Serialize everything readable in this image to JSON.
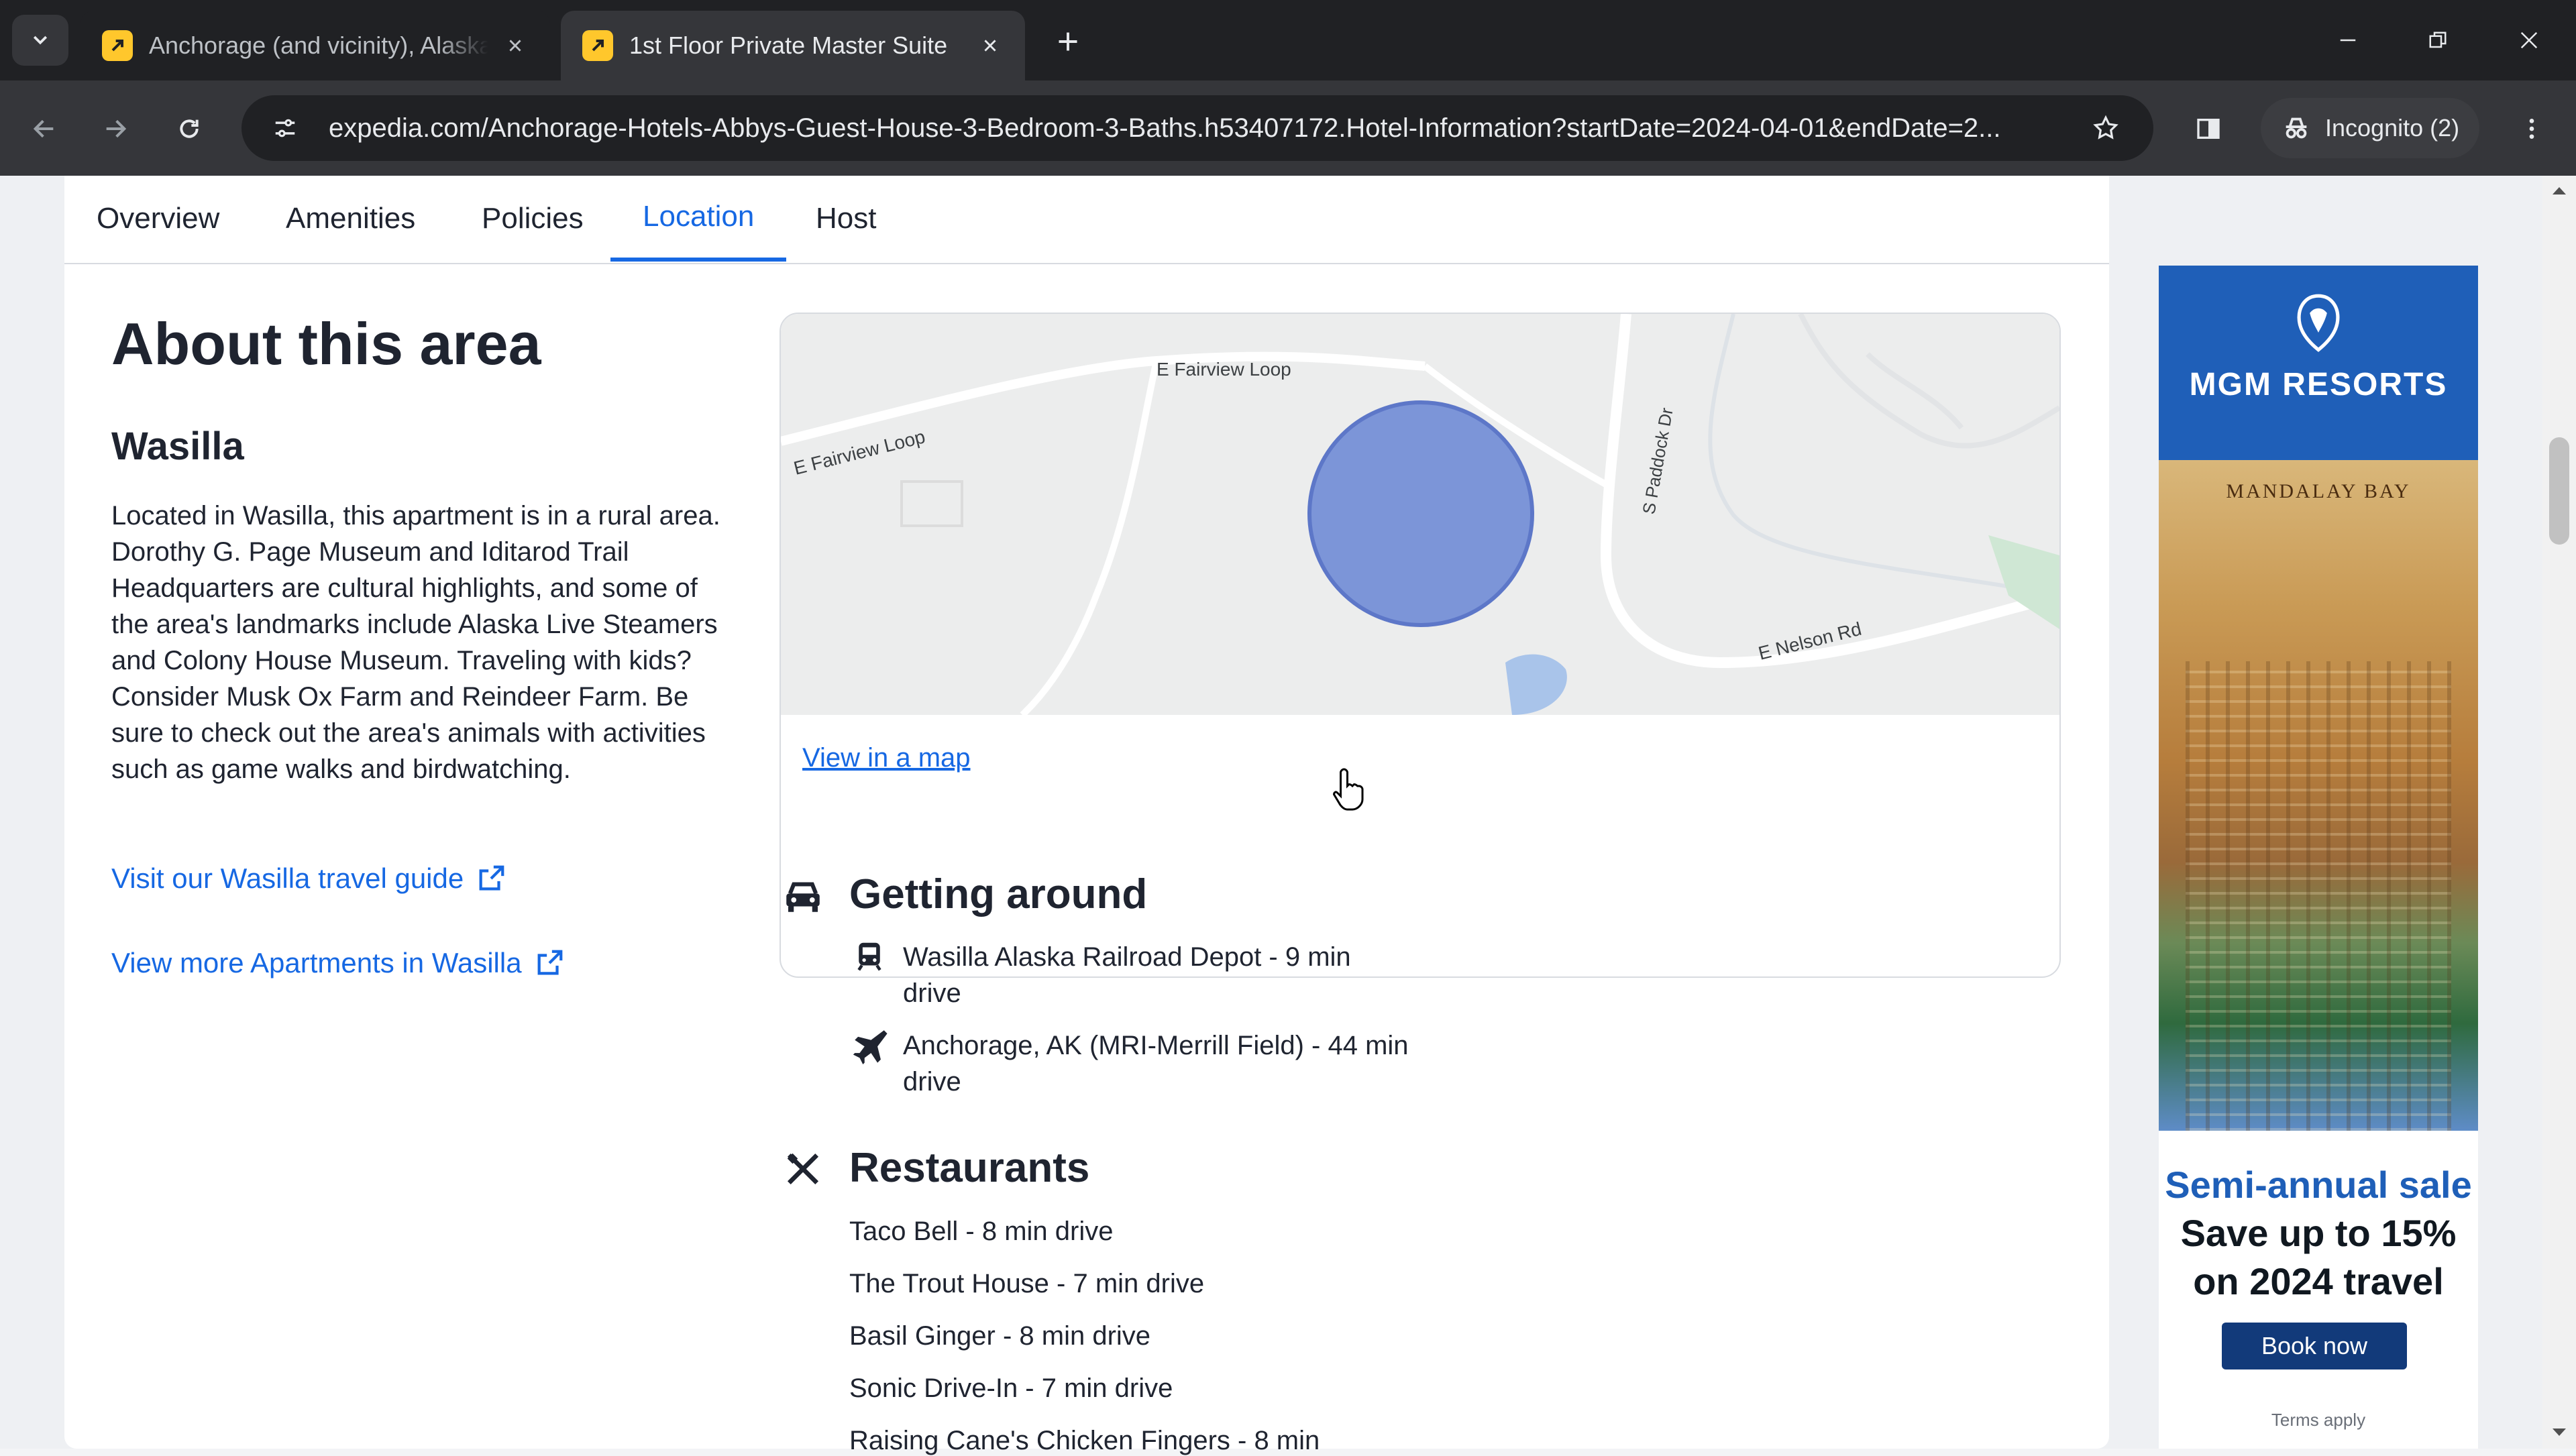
{
  "browser": {
    "tabs": [
      {
        "title": "Anchorage (and vicinity), Alaska",
        "active": false
      },
      {
        "title": "1st Floor Private Master Suite",
        "active": true
      }
    ],
    "url": "expedia.com/Anchorage-Hotels-Abbys-Guest-House-3-Bedroom-3-Baths.h53407172.Hotel-Information?startDate=2024-04-01&endDate=2...",
    "incognito_label": "Incognito (2)"
  },
  "subnav": {
    "items": [
      "Overview",
      "Amenities",
      "Policies",
      "Location",
      "Host"
    ],
    "active": "Location"
  },
  "area": {
    "heading": "About this area",
    "city": "Wasilla",
    "description": "Located in Wasilla, this apartment is in a rural area. Dorothy G. Page Museum and Iditarod Trail Headquarters are cultural highlights, and some of the area's landmarks include Alaska Live Steamers and Colony House Museum. Traveling with kids? Consider Musk Ox Farm and Reindeer Farm. Be sure to check out the area's animals with activities such as game walks and birdwatching.",
    "travel_guide_link": "Visit our Wasilla travel guide",
    "more_apartments_link": "View more Apartments in Wasilla"
  },
  "map": {
    "labels": {
      "road1": "E Fairview Loop",
      "road2": "E Fairview Loop",
      "road3": "S Paddock Dr",
      "road4": "E Nelson Rd"
    },
    "view_link": "View in a map",
    "marker_color": "#7c95d8"
  },
  "getting_around": {
    "title": "Getting around",
    "items": [
      {
        "icon": "train-icon",
        "text": "Wasilla Alaska Railroad Depot - 9 min drive"
      },
      {
        "icon": "airplane-icon",
        "text": "Anchorage, AK (MRI-Merrill Field) - 44 min drive"
      }
    ]
  },
  "restaurants": {
    "title": "Restaurants",
    "items": [
      "Taco Bell - 8 min drive",
      "The Trout House - 7 min drive",
      "Basil Ginger - 8 min drive",
      "Sonic Drive-In - 7 min drive",
      "Raising Cane's Chicken Fingers - 8 min"
    ]
  },
  "ad": {
    "brand": "MGM RESORTS",
    "property": "MANDALAY BAY",
    "line1": "Semi-annual sale",
    "line2": "Save up to 15%",
    "line3": "on 2024 travel",
    "button": "Book now",
    "terms": "Terms apply"
  },
  "colors": {
    "accent": "#1668e3",
    "chrome_dark": "#202124",
    "chrome_mid": "#35363a"
  }
}
